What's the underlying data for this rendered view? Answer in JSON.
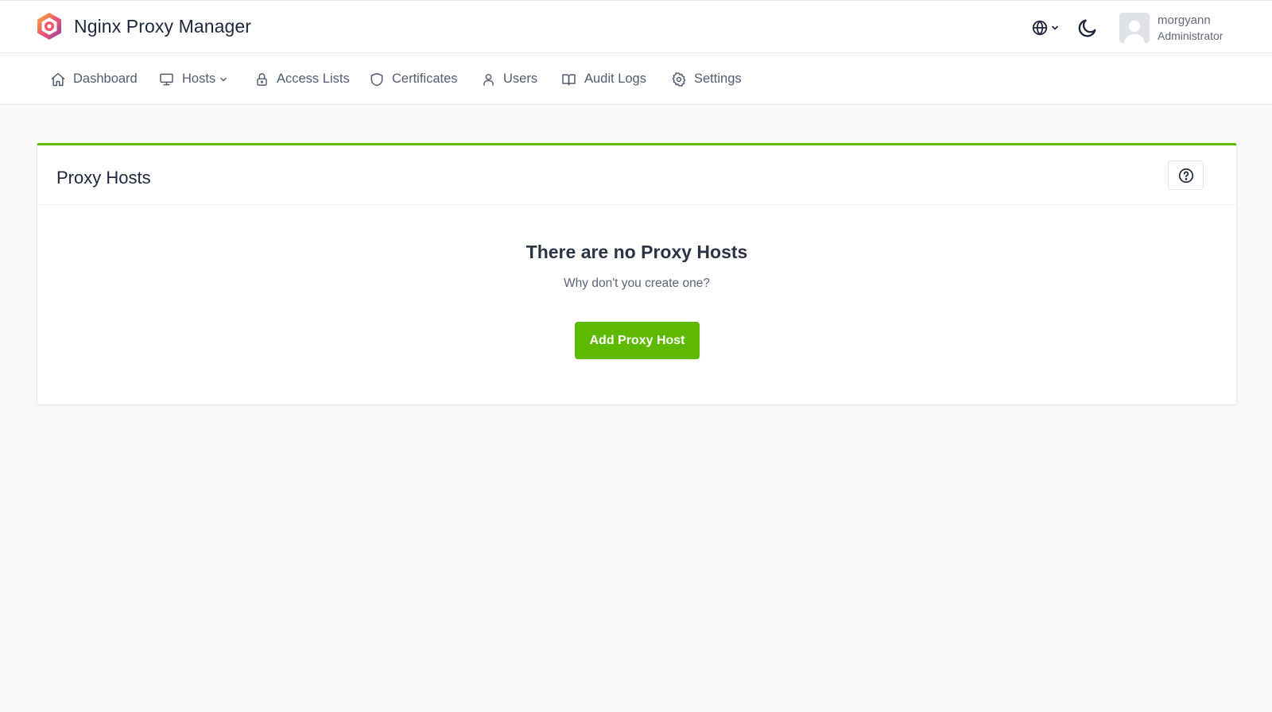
{
  "app": {
    "title": "Nginx Proxy Manager"
  },
  "header": {
    "language_icon": "globe-icon",
    "theme_icon": "moon-icon",
    "user": {
      "name": "morgyann",
      "role": "Administrator"
    }
  },
  "nav": {
    "items": [
      {
        "label": "Dashboard",
        "icon": "home-icon"
      },
      {
        "label": "Hosts",
        "icon": "monitor-icon",
        "has_dropdown": true
      },
      {
        "label": "Access Lists",
        "icon": "lock-icon"
      },
      {
        "label": "Certificates",
        "icon": "shield-icon"
      },
      {
        "label": "Users",
        "icon": "user-icon"
      },
      {
        "label": "Audit Logs",
        "icon": "book-icon"
      },
      {
        "label": "Settings",
        "icon": "gear-icon"
      }
    ]
  },
  "main": {
    "card_title": "Proxy Hosts",
    "help_icon": "help-icon",
    "empty_title": "There are no Proxy Hosts",
    "empty_subtitle": "Why don't you create one?",
    "add_button_label": "Add Proxy Host"
  },
  "colors": {
    "accent": "#5eba00",
    "text": "#1d273b",
    "muted": "#525c6e",
    "background": "#f8f9fb"
  }
}
